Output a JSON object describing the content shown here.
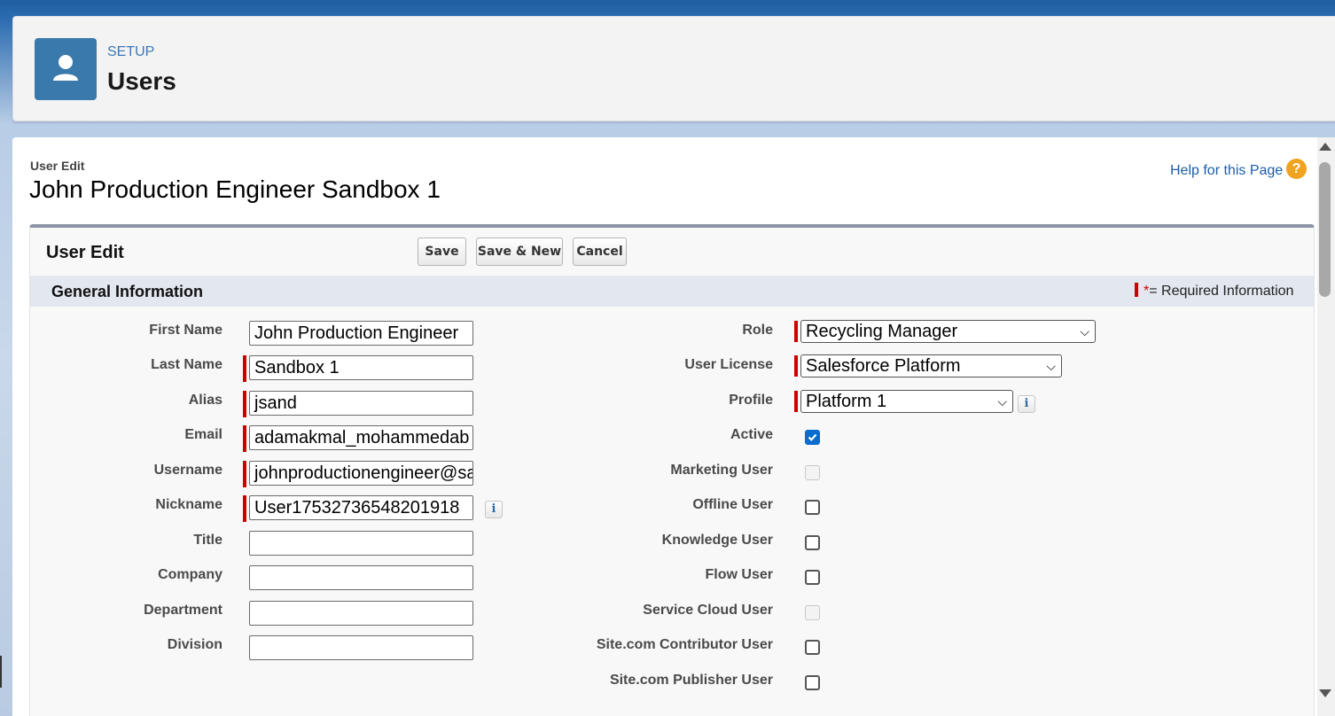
{
  "header": {
    "eyebrow": "SETUP",
    "title": "Users",
    "icon": "user-icon"
  },
  "page": {
    "eyebrow": "User Edit",
    "title": "John Production Engineer Sandbox 1",
    "help_link": "Help for this Page",
    "help_icon": "?"
  },
  "block": {
    "title": "User Edit",
    "buttons": {
      "save": "Save",
      "save_new": "Save & New",
      "cancel": "Cancel"
    },
    "section_title": "General Information",
    "required_legend": "= Required Information",
    "required_star": "*"
  },
  "left_fields": {
    "first_name": {
      "label": "First Name",
      "value": "John Production Engineer"
    },
    "last_name": {
      "label": "Last Name",
      "value": "Sandbox 1"
    },
    "alias": {
      "label": "Alias",
      "value": "jsand"
    },
    "email": {
      "label": "Email",
      "value": "adamakmal_mohammedab"
    },
    "username": {
      "label": "Username",
      "value": "johnproductionengineer@sa"
    },
    "nickname": {
      "label": "Nickname",
      "value": "User17532736548201918"
    },
    "title": {
      "label": "Title",
      "value": ""
    },
    "company": {
      "label": "Company",
      "value": ""
    },
    "department": {
      "label": "Department",
      "value": ""
    },
    "division": {
      "label": "Division",
      "value": ""
    }
  },
  "right_fields": {
    "role": {
      "label": "Role",
      "value": "Recycling Manager"
    },
    "user_license": {
      "label": "User License",
      "value": "Salesforce Platform"
    },
    "profile": {
      "label": "Profile",
      "value": "Platform 1"
    },
    "active": {
      "label": "Active",
      "checked": true
    },
    "marketing_user": {
      "label": "Marketing User",
      "checked": false,
      "disabled": true
    },
    "offline_user": {
      "label": "Offline User",
      "checked": false
    },
    "knowledge_user": {
      "label": "Knowledge User",
      "checked": false
    },
    "flow_user": {
      "label": "Flow User",
      "checked": false
    },
    "service_cloud_user": {
      "label": "Service Cloud User",
      "checked": false,
      "disabled": true
    },
    "site_contributor_user": {
      "label": "Site.com Contributor User",
      "checked": false
    },
    "site_publisher_user": {
      "label": "Site.com Publisher User",
      "checked": false
    }
  },
  "info_icon": "i",
  "dropdown_icon": "chevron-down-icon",
  "colors": {
    "required": "#cc0000",
    "header_icon_bg": "#3a79ab",
    "link": "#1b5ea8",
    "checkbox_checked": "#0a6ccf"
  }
}
